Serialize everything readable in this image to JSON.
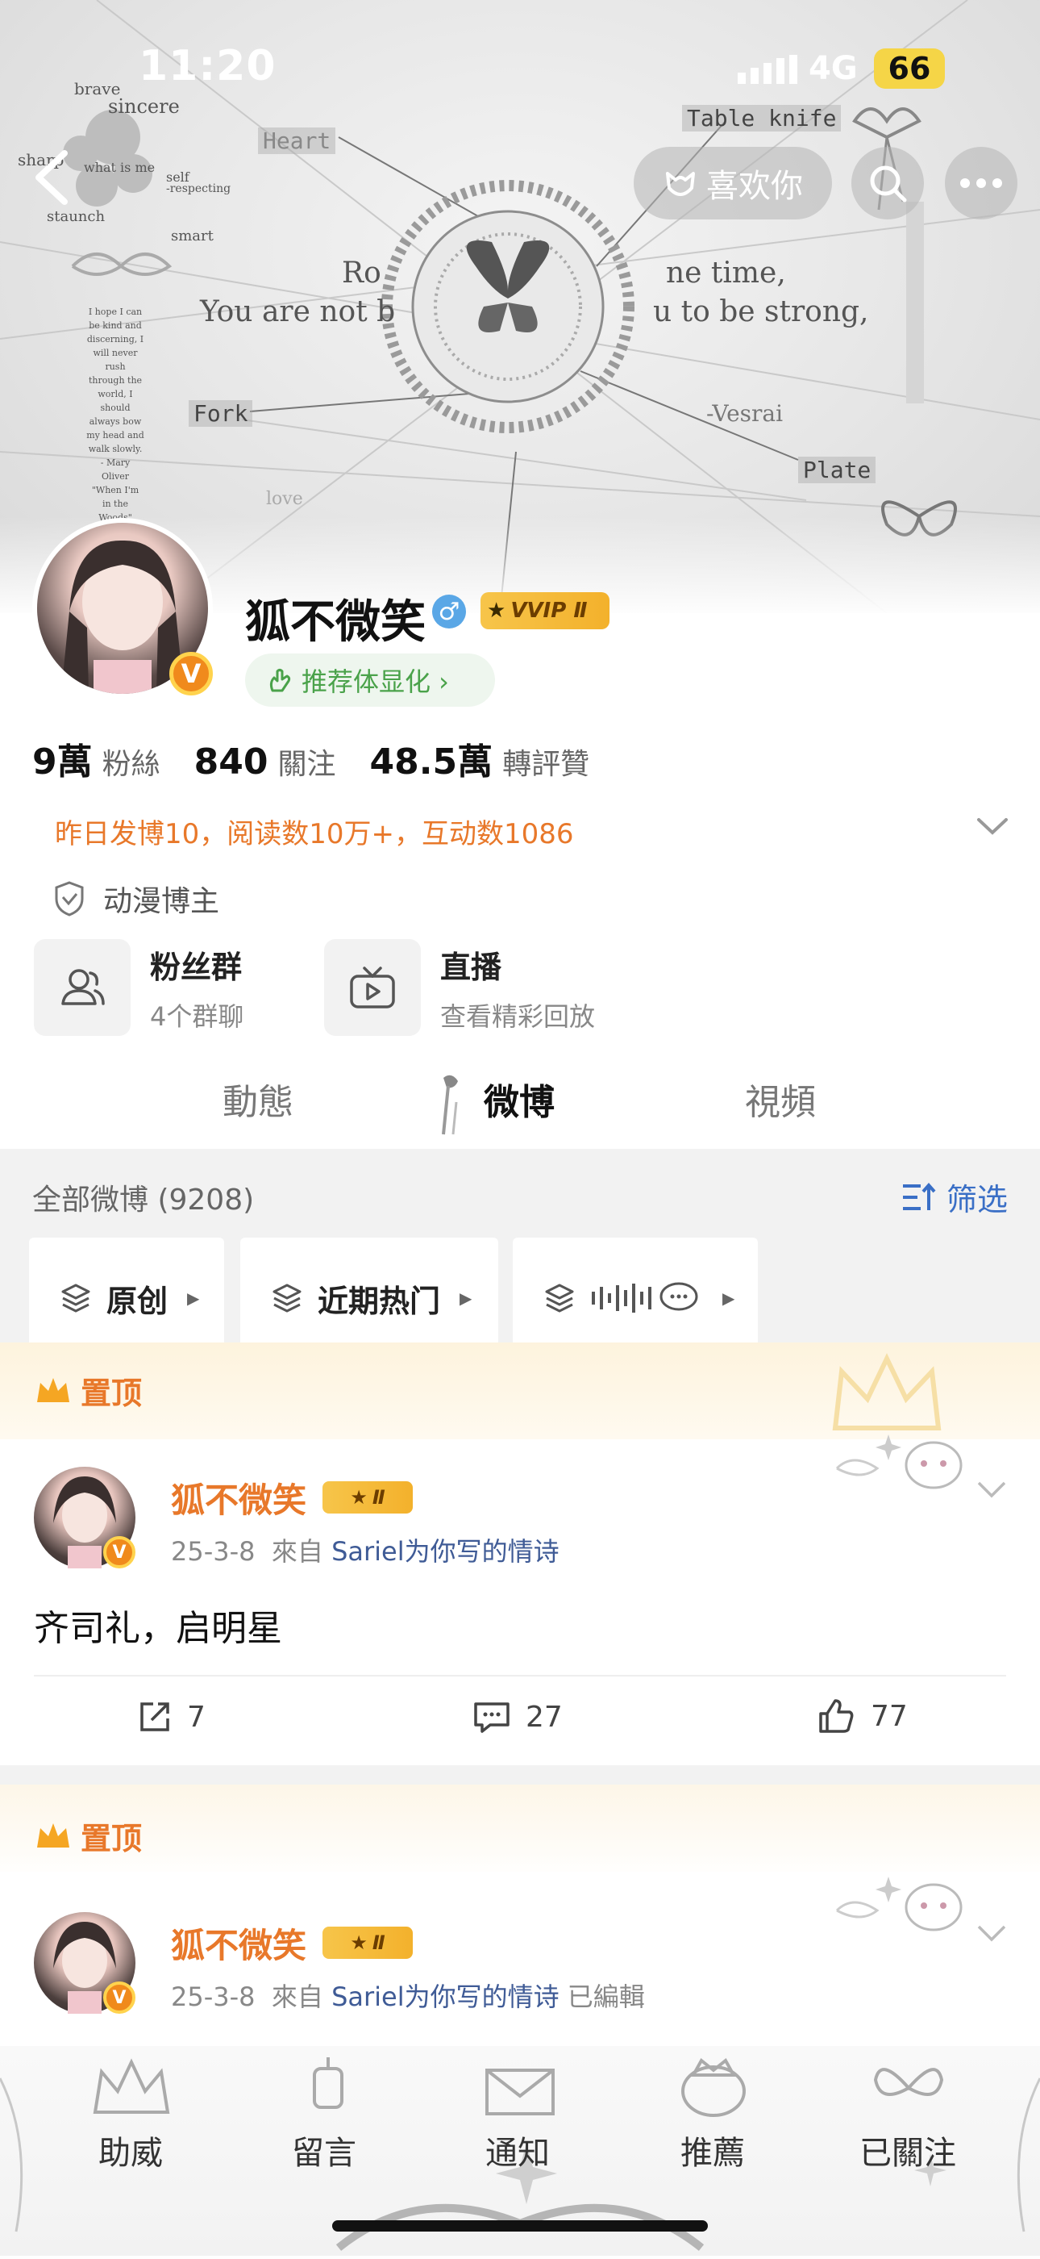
{
  "status_bar": {
    "time": "11:20",
    "network": "4G",
    "battery": "66"
  },
  "banner": {
    "words": [
      "brave",
      "sincere",
      "sharp",
      "what is me",
      "self",
      "-respecting",
      "staunch",
      "smart",
      "Heart",
      "Table knife",
      "Fork",
      "Plate",
      "-Vesrai",
      "love"
    ],
    "quote_line1_left": "Ro",
    "quote_line1_right": "ne time,",
    "quote_line2_left": "You are not b",
    "quote_line2_right": "u to be strong,",
    "poem": [
      "I hope I can",
      "be kind and",
      "discerning, I",
      "will never",
      "rush",
      "through the",
      "world, I",
      "should",
      "always bow",
      "my head and",
      "walk slowly.",
      "- Mary",
      "Oliver",
      "\"When I'm",
      "in the",
      "Woods\""
    ]
  },
  "header": {
    "like_button": "喜欢你"
  },
  "profile": {
    "name": "狐不微笑",
    "gender_symbol": "♂",
    "vip_badge": "VVIP Ⅱ",
    "verified_mark": "V",
    "recommend": "推荐体显化 ›",
    "stats": [
      {
        "value": "9萬",
        "label": "粉絲"
      },
      {
        "value": "840",
        "label": "關注"
      },
      {
        "value": "48.5萬",
        "label": "轉評贊"
      }
    ],
    "daily_summary": "昨日发博10，阅读数10万+，互动数1086",
    "category": "动漫博主",
    "cards": [
      {
        "title": "粉丝群",
        "subtitle": "4个群聊",
        "icon": "group-icon"
      },
      {
        "title": "直播",
        "subtitle": "查看精彩回放",
        "icon": "tv-icon"
      }
    ]
  },
  "tabs": [
    {
      "label": "動態",
      "active": false
    },
    {
      "label": "微博",
      "active": true
    },
    {
      "label": "視頻",
      "active": false
    }
  ],
  "feed": {
    "count_label": "全部微博 (9208)",
    "filter_label": "筛选",
    "chips": [
      {
        "label": "原创"
      },
      {
        "label": "近期热门"
      },
      {
        "label": ""
      }
    ],
    "pinned_label": "置顶",
    "posts": [
      {
        "author": "狐不微笑",
        "vip": "Ⅱ",
        "date": "25-3-8",
        "from_prefix": "來自",
        "source": "Sariel为你写的情诗",
        "edited": "",
        "body": "齐司礼，启明星",
        "shares": "7",
        "comments": "27",
        "likes": "77"
      },
      {
        "author": "狐不微笑",
        "vip": "Ⅱ",
        "date": "25-3-8",
        "from_prefix": "來自",
        "source": "Sariel为你写的情诗",
        "edited": "已編輯"
      }
    ]
  },
  "bottom_nav": [
    {
      "label": "助威"
    },
    {
      "label": "留言"
    },
    {
      "label": "通知"
    },
    {
      "label": "推薦"
    },
    {
      "label": "已關注"
    }
  ],
  "colors": {
    "accent_orange": "#e8782a",
    "link_blue": "#3a6fc6",
    "vip_gold": "#f3b12c"
  }
}
